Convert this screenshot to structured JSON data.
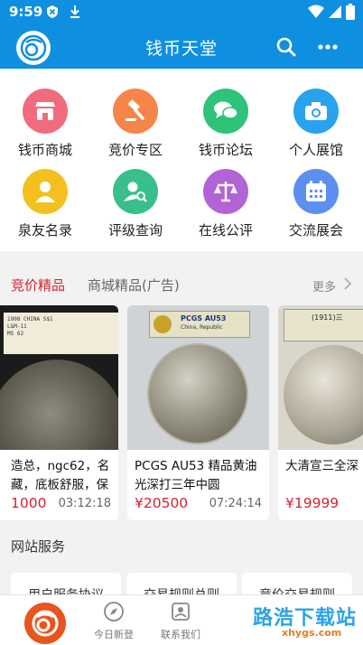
{
  "status_bar": {
    "time": "9:59"
  },
  "header": {
    "title": "钱币天堂",
    "brand_color": "#0f8fe0"
  },
  "grid": [
    {
      "label": "钱币商城",
      "icon": "shop-icon",
      "color": "#f06b7d"
    },
    {
      "label": "竞价专区",
      "icon": "auction-hammer-icon",
      "color": "#f6854a"
    },
    {
      "label": "钱币论坛",
      "icon": "chat-bubbles-icon",
      "color": "#2fc27a"
    },
    {
      "label": "个人展馆",
      "icon": "camera-icon",
      "color": "#29a3ee"
    },
    {
      "label": "泉友名录",
      "icon": "user-icon",
      "color": "#f4c020"
    },
    {
      "label": "评级查询",
      "icon": "search-person-icon",
      "color": "#39c08a"
    },
    {
      "label": "在线公评",
      "icon": "scales-icon",
      "color": "#b264d6"
    },
    {
      "label": "交流展会",
      "icon": "calendar-icon",
      "color": "#5b8ff0"
    }
  ],
  "tabs": {
    "active": "竞价精品",
    "other": "商城精品(广告)",
    "more": "更多"
  },
  "products": [
    {
      "name": "造总，ngc62，名藏，底板舒服，保",
      "price": "1000",
      "time": "03:12:18",
      "label_text": "1908 CHINA S$1\nL&M-11\nMS 62"
    },
    {
      "name": "PCGS AU53 精品黄油光深打三年中圆",
      "price": "¥20500",
      "time": "07:24:14",
      "label_text": "PCGS AU53",
      "label_sub": "China, Republic"
    },
    {
      "name": "大清宣三全深",
      "price": "¥19999",
      "time": "",
      "label_text": "(1911)三"
    }
  ],
  "services": {
    "title": "网站服务",
    "items": [
      "用户服务协议",
      "交易规则总则",
      "竞价交易规则"
    ]
  },
  "bottom_nav": {
    "items": [
      {
        "label": "",
        "icon": "home-logo-icon"
      },
      {
        "label": "今日新登",
        "icon": "compass-icon"
      },
      {
        "label": "联系我们",
        "icon": "contact-icon"
      }
    ]
  },
  "watermark": {
    "text": "路浩下载站",
    "sub": "xhygs.com"
  }
}
